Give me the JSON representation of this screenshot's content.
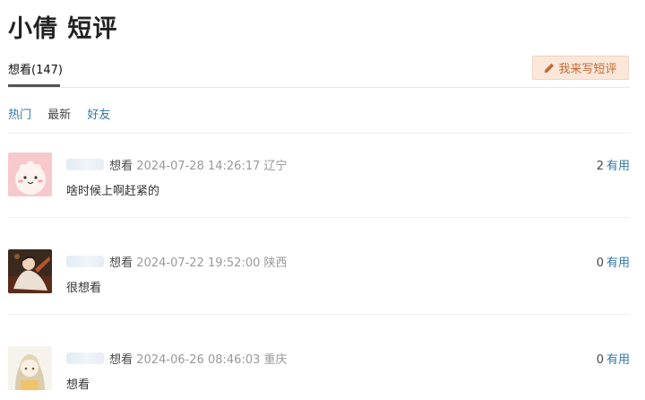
{
  "page": {
    "title": "小倩 短评"
  },
  "tabs": {
    "want_label": "想看(147)"
  },
  "actions": {
    "write_label": "我来写短评"
  },
  "sort": {
    "hot": "热门",
    "newest": "最新",
    "friends": "好友"
  },
  "comments": [
    {
      "status": "想看",
      "time": "2024-07-28 14:26:17",
      "location": "辽宁",
      "content": "啥时候上啊赶紧的",
      "votes": "2",
      "vote_label": "有用",
      "avatar_icon": "cartoon-dumpling-avatar"
    },
    {
      "status": "想看",
      "time": "2024-07-22 19:52:00",
      "location": "陕西",
      "content": "很想看",
      "votes": "0",
      "vote_label": "有用",
      "avatar_icon": "costume-figure-avatar"
    },
    {
      "status": "想看",
      "time": "2024-06-26 08:46:03",
      "location": "重庆",
      "content": "想看",
      "votes": "0",
      "vote_label": "有用",
      "avatar_icon": "anime-girl-avatar"
    }
  ],
  "colors": {
    "link": "#3377aa",
    "button_bg": "#fbe7d9",
    "button_text": "#c16a38",
    "meta_gray": "#999999"
  }
}
